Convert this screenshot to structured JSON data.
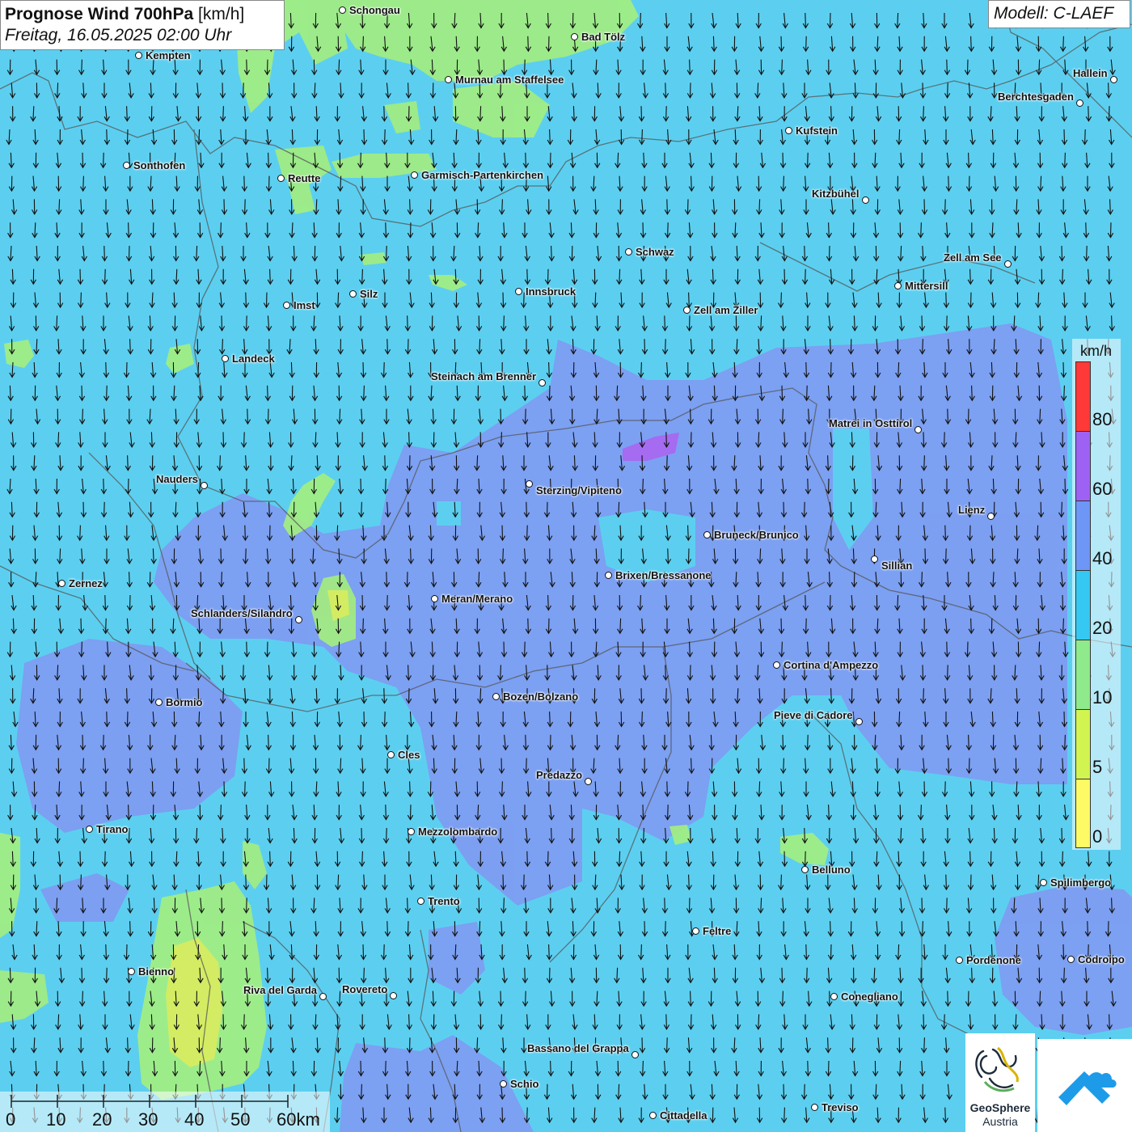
{
  "title": {
    "bold": "Prognose Wind 700hPa",
    "unit": "[km/h]",
    "datetime": "Freitag, 16.05.2025 02:00 Uhr"
  },
  "model": "Modell: C-LAEF",
  "legend": {
    "unit": "km/h",
    "labels": [
      "80",
      "60",
      "40",
      "20",
      "10",
      "5",
      "0"
    ],
    "colors": [
      "#ff3838",
      "#9d62f4",
      "#6e96f6",
      "#35c8f3",
      "#8eea8a",
      "#d2f450",
      "#fdfa66"
    ]
  },
  "scale": {
    "labels": [
      "0",
      "10",
      "20",
      "30",
      "40",
      "50",
      "60km"
    ]
  },
  "logos": {
    "geosphere_name": "GeoSphere",
    "geosphere_sub": "Austria"
  },
  "places": [
    {
      "name": "Schongau"
    },
    {
      "name": "Bad Tölz"
    },
    {
      "name": "Kempten"
    },
    {
      "name": "Murnau am Staffelsee"
    },
    {
      "name": "Hallein"
    },
    {
      "name": "Berchtesgaden"
    },
    {
      "name": "Kufstein"
    },
    {
      "name": "Sonthofen"
    },
    {
      "name": "Reutte"
    },
    {
      "name": "Garmisch-Partenkirchen"
    },
    {
      "name": "Kitzbühel"
    },
    {
      "name": "Schwaz"
    },
    {
      "name": "Zell am See"
    },
    {
      "name": "Mittersill"
    },
    {
      "name": "Silz"
    },
    {
      "name": "Innsbruck"
    },
    {
      "name": "Imst"
    },
    {
      "name": "Zell am Ziller"
    },
    {
      "name": "Landeck"
    },
    {
      "name": "Steinach am Brenner"
    },
    {
      "name": "Matrei in Osttirol"
    },
    {
      "name": "Nauders"
    },
    {
      "name": "Sterzing/Vipiteno"
    },
    {
      "name": "Lienz"
    },
    {
      "name": "Bruneck/Brunico"
    },
    {
      "name": "Sillian"
    },
    {
      "name": "Zernez"
    },
    {
      "name": "Brixen/Bressanone"
    },
    {
      "name": "Meran/Merano"
    },
    {
      "name": "Schlanders/Silandro"
    },
    {
      "name": "Cortina d'Ampezzo"
    },
    {
      "name": "Bozen/Bolzano"
    },
    {
      "name": "Bormio"
    },
    {
      "name": "Pieve di Cadore"
    },
    {
      "name": "Cles"
    },
    {
      "name": "Predazzo"
    },
    {
      "name": "Tirano"
    },
    {
      "name": "Mezzolombardo"
    },
    {
      "name": "Belluno"
    },
    {
      "name": "Spilimbergo"
    },
    {
      "name": "Trento"
    },
    {
      "name": "Feltre"
    },
    {
      "name": "Pordenone"
    },
    {
      "name": "Codroipo"
    },
    {
      "name": "Bienno"
    },
    {
      "name": "Riva del Garda"
    },
    {
      "name": "Rovereto"
    },
    {
      "name": "Conegliano"
    },
    {
      "name": "Bassano del Grappa"
    },
    {
      "name": "Schio"
    },
    {
      "name": "Cittadella"
    },
    {
      "name": "Treviso"
    }
  ],
  "wind_direction": "north to south"
}
